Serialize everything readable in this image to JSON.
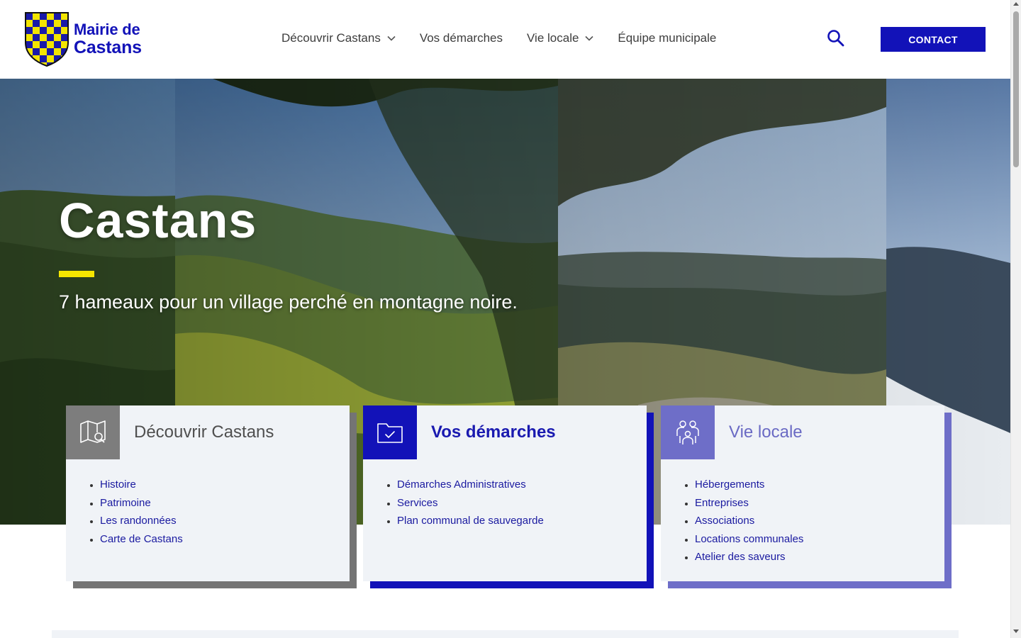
{
  "header": {
    "logo_line1": "Mairie de",
    "logo_line2": "Castans",
    "nav": [
      {
        "label": "Découvrir Castans",
        "has_dropdown": true
      },
      {
        "label": "Vos démarches",
        "has_dropdown": false
      },
      {
        "label": "Vie locale",
        "has_dropdown": true
      },
      {
        "label": "Équipe municipale",
        "has_dropdown": false
      }
    ],
    "search_icon": "search-icon",
    "contact_label": "CONTACT"
  },
  "hero": {
    "title": "Castans",
    "subtitle": "7 hameaux pour un village perché en montagne noire."
  },
  "cards": [
    {
      "title": "Découvrir Castans",
      "icon": "map-search-icon",
      "color": "#7d7d7d",
      "items": [
        "Histoire",
        "Patrimoine",
        "Les randonnées",
        "Carte de Castans"
      ]
    },
    {
      "title": "Vos démarches",
      "icon": "folder-check-icon",
      "color": "#1212b8",
      "items": [
        "Démarches Administratives",
        "Services",
        "Plan communal de sauvegarde"
      ]
    },
    {
      "title": "Vie locale",
      "icon": "people-icon",
      "color": "#6e6ec8",
      "items": [
        "Hébergements",
        "Entreprises",
        "Associations",
        "Locations communales",
        "Atelier des saveurs"
      ]
    }
  ],
  "colors": {
    "brand_blue": "#1212b8",
    "accent_yellow": "#f5e600",
    "card_bg": "#f0f3f7"
  }
}
